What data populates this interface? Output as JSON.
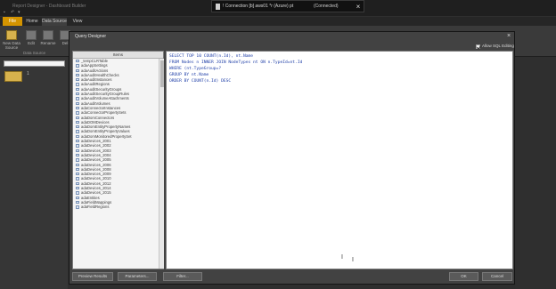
{
  "app": {
    "title": "Report Designer - Dashboard Builder",
    "rdp_title": "! Connection [b] aws01 *r (Azure) pt",
    "rdp_status": "(Connected)",
    "file_tab": "File",
    "tabs": [
      "Home",
      "Data Source",
      "View"
    ]
  },
  "ribbon": {
    "buttons": [
      "New Data Source",
      "Edit",
      "Rename",
      "Del"
    ],
    "group_label": "Data Source"
  },
  "left_panel": {
    "mark": "1"
  },
  "dialog": {
    "title": "Query Designer",
    "allow_sql": "Allow SQL Editing",
    "items_header": "Items",
    "items": [
      "_tempCLRTable",
      "adaAppSettings",
      "adaAuditActions",
      "adaAuditHealthChecks",
      "adaAuditInstances",
      "adaAuditRegions",
      "adaAuditSecurityGroups",
      "adaAuditSecurityGroupRules",
      "adaAuditVolumeAttachments",
      "adaAuditVolumes",
      "adaConnectorInstances",
      "adaConnectorPropertySets",
      "adaDomConnectors",
      "adaDOMDevices",
      "adaDomEntityPropertyNames",
      "adaDomEntityPropertyValues",
      "adaDomMonitoredPropertySet",
      "adaDevices_2001",
      "adaDevices_2002",
      "adaDevices_2003",
      "adaDevices_2004",
      "adaDevices_2005",
      "adaDevices_2006",
      "adaDevices_2008",
      "adaDevices_2009",
      "adaDevices_2010",
      "adaDevices_2012",
      "adaDevices_2014",
      "adaDevices_2015",
      "adaEntities",
      "adaFieldMappings",
      "adaFieldRegions"
    ],
    "sql_lines": [
      "SELECT TOP 10 COUNT(n.Id), nt.Name",
      "FROM Nodes n INNER JOIN NodeTypes nt ON n.TypeId=nt.Id",
      "WHERE (nt.TypeGroup=?",
      "GROUP BY nt.Name",
      "ORDER BY COUNT(n.Id) DESC"
    ],
    "buttons": {
      "preview": "Preview Results",
      "parameters": "Parameters...",
      "filter": "Filter...",
      "ok": "OK",
      "cancel": "Cancel"
    }
  },
  "colors": {
    "accent": "#d49400",
    "sql_keyword": "#2140a8"
  }
}
